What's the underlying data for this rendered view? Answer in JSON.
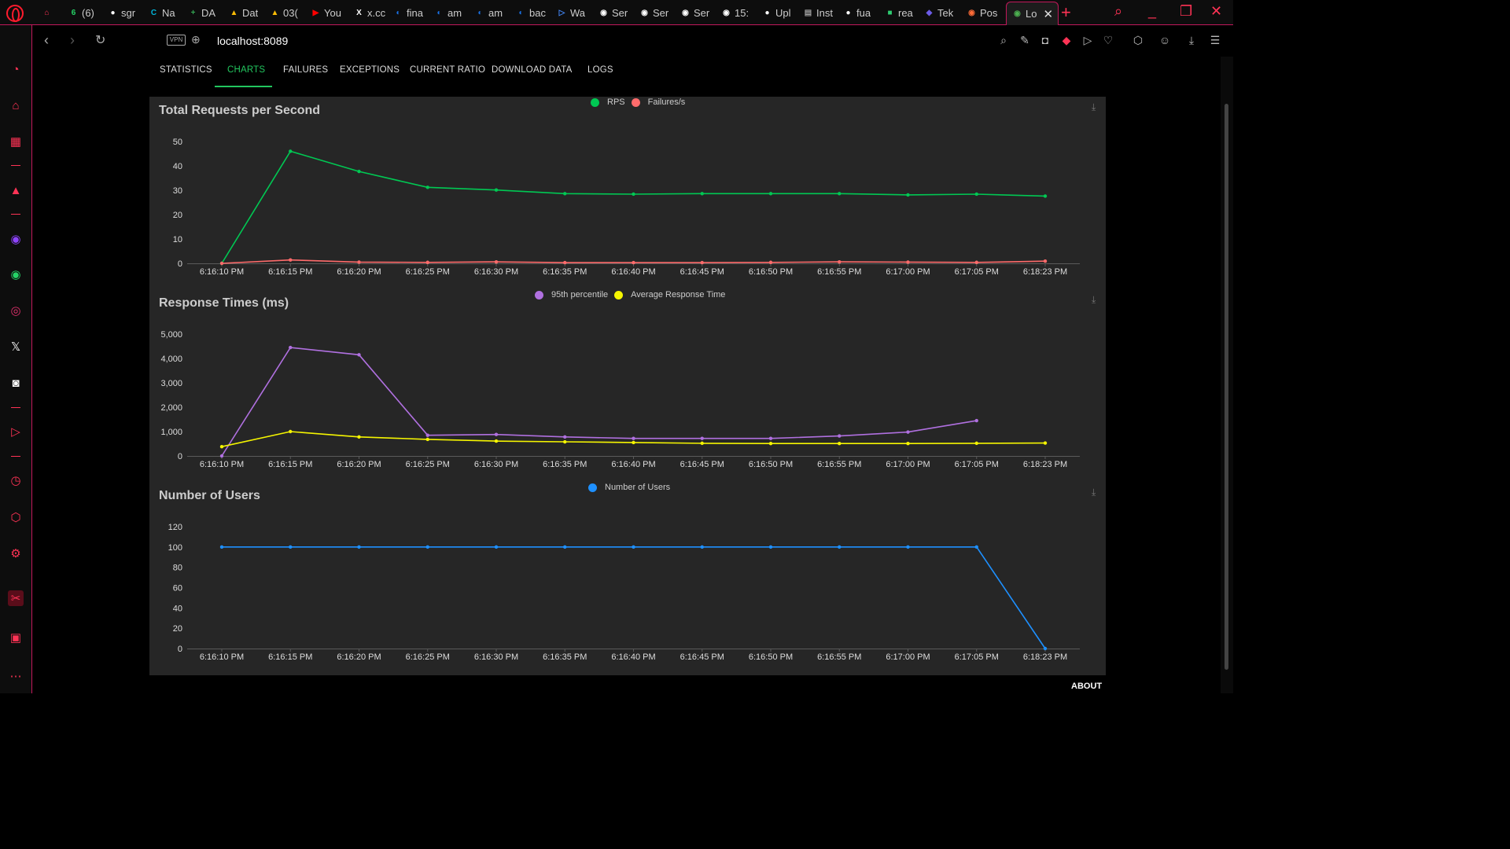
{
  "browser": {
    "tabs": [
      {
        "label": "",
        "color": "#ff3355",
        "glyph": "⌂"
      },
      {
        "label": "(6)",
        "color": "#25d366",
        "glyph": "6"
      },
      {
        "label": "sgr",
        "color": "#ffffff",
        "glyph": "●"
      },
      {
        "label": "Na",
        "color": "#00b4d8",
        "glyph": "C"
      },
      {
        "label": "DA",
        "color": "#34a853",
        "glyph": "+"
      },
      {
        "label": "Dat",
        "color": "#fbbc04",
        "glyph": "▲"
      },
      {
        "label": "03(",
        "color": "#fbbc04",
        "glyph": "▲"
      },
      {
        "label": "You",
        "color": "#ff0000",
        "glyph": "▶"
      },
      {
        "label": "x.cc",
        "color": "#ffffff",
        "glyph": "X"
      },
      {
        "label": "fina",
        "color": "#1a73e8",
        "glyph": "◐"
      },
      {
        "label": "am",
        "color": "#1a73e8",
        "glyph": "◐"
      },
      {
        "label": "am",
        "color": "#1a73e8",
        "glyph": "◐"
      },
      {
        "label": "bac",
        "color": "#1a73e8",
        "glyph": "◐"
      },
      {
        "label": "Wa",
        "color": "#4285f4",
        "glyph": "▷"
      },
      {
        "label": "Ser",
        "color": "#ffffff",
        "glyph": "◉"
      },
      {
        "label": "Ser",
        "color": "#ffffff",
        "glyph": "◉"
      },
      {
        "label": "Ser",
        "color": "#ffffff",
        "glyph": "◉"
      },
      {
        "label": "15:",
        "color": "#ffffff",
        "glyph": "◉"
      },
      {
        "label": "Upl",
        "color": "#ffffff",
        "glyph": "●"
      },
      {
        "label": "Inst",
        "color": "#9e9e9e",
        "glyph": "▤"
      },
      {
        "label": "fua",
        "color": "#ffffff",
        "glyph": "●"
      },
      {
        "label": "rea",
        "color": "#2ecc71",
        "glyph": "■"
      },
      {
        "label": "Tek",
        "color": "#6c5ce7",
        "glyph": "◆"
      },
      {
        "label": "Pos",
        "color": "#ff6c37",
        "glyph": "◉"
      },
      {
        "label": "Lo",
        "color": "#4caf50",
        "glyph": "◉"
      }
    ],
    "url": "localhost:8089",
    "vpn_label": "VPN"
  },
  "nav": {
    "tabs": [
      "STATISTICS",
      "CHARTS",
      "FAILURES",
      "EXCEPTIONS",
      "CURRENT RATIO",
      "DOWNLOAD DATA",
      "LOGS"
    ],
    "active": "CHARTS"
  },
  "footer": {
    "about": "ABOUT"
  },
  "chart_data": [
    {
      "type": "line",
      "title": "Total Requests per Second",
      "x": [
        "6:16:10 PM",
        "6:16:15 PM",
        "6:16:20 PM",
        "6:16:25 PM",
        "6:16:30 PM",
        "6:16:35 PM",
        "6:16:40 PM",
        "6:16:45 PM",
        "6:16:50 PM",
        "6:16:55 PM",
        "6:17:00 PM",
        "6:17:05 PM",
        "6:18:23 PM"
      ],
      "ylim": [
        0,
        50
      ],
      "yticks": [
        0,
        10,
        20,
        30,
        40,
        50
      ],
      "ytick_labels": [
        "0",
        "10",
        "20",
        "30",
        "40",
        "50"
      ],
      "series": [
        {
          "name": "RPS",
          "color": "#00c853",
          "values": [
            0,
            46,
            37.7,
            31.2,
            30.1,
            28.6,
            28.4,
            28.6,
            28.6,
            28.6,
            28.1,
            28.4,
            27.6
          ]
        },
        {
          "name": "Failures/s",
          "color": "#ff6b6b",
          "values": [
            0,
            1.4,
            0.5,
            0.4,
            0.6,
            0.3,
            0.3,
            0.3,
            0.4,
            0.6,
            0.5,
            0.4,
            0.9
          ]
        }
      ],
      "legend": "top-center"
    },
    {
      "type": "line",
      "title": "Response Times (ms)",
      "x": [
        "6:16:10 PM",
        "6:16:15 PM",
        "6:16:20 PM",
        "6:16:25 PM",
        "6:16:30 PM",
        "6:16:35 PM",
        "6:16:40 PM",
        "6:16:45 PM",
        "6:16:50 PM",
        "6:16:55 PM",
        "6:17:00 PM",
        "6:17:05 PM",
        "6:18:23 PM"
      ],
      "ylim": [
        0,
        5000
      ],
      "yticks": [
        0,
        1000,
        2000,
        3000,
        4000,
        5000
      ],
      "ytick_labels": [
        "0",
        "1,000",
        "2,000",
        "3,000",
        "4,000",
        "5,000"
      ],
      "series": [
        {
          "name": "95th percentile",
          "color": "#b070e0",
          "values": [
            0,
            4450,
            4150,
            850,
            880,
            780,
            720,
            720,
            720,
            820,
            980,
            1450,
            null
          ]
        },
        {
          "name": "Average Response Time",
          "color": "#f5f500",
          "values": [
            380,
            1000,
            780,
            680,
            610,
            580,
            550,
            520,
            510,
            510,
            510,
            520,
            530
          ]
        }
      ],
      "legend": "top-center"
    },
    {
      "type": "line",
      "title": "Number of Users",
      "x": [
        "6:16:10 PM",
        "6:16:15 PM",
        "6:16:20 PM",
        "6:16:25 PM",
        "6:16:30 PM",
        "6:16:35 PM",
        "6:16:40 PM",
        "6:16:45 PM",
        "6:16:50 PM",
        "6:16:55 PM",
        "6:17:00 PM",
        "6:17:05 PM",
        "6:18:23 PM"
      ],
      "ylim": [
        0,
        120
      ],
      "yticks": [
        0,
        20,
        40,
        60,
        80,
        100,
        120
      ],
      "ytick_labels": [
        "0",
        "20",
        "40",
        "60",
        "80",
        "100",
        "120"
      ],
      "series": [
        {
          "name": "Number of Users",
          "color": "#1e90ff",
          "values": [
            100,
            100,
            100,
            100,
            100,
            100,
            100,
            100,
            100,
            100,
            100,
            100,
            0
          ]
        }
      ],
      "legend": "top-center"
    }
  ]
}
